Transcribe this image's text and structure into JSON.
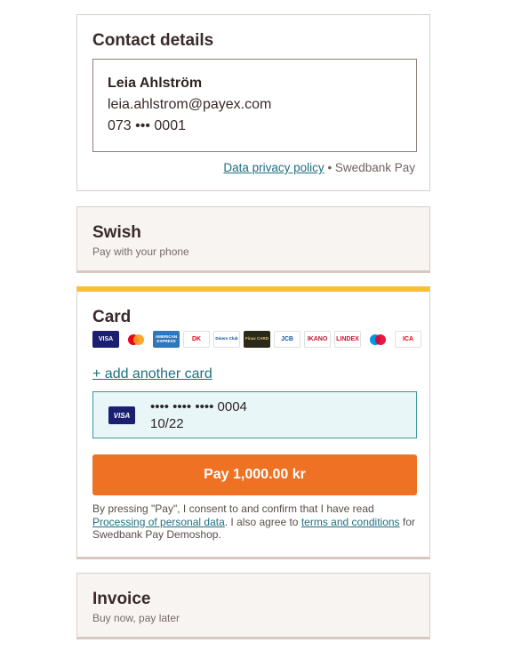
{
  "contact": {
    "title": "Contact details",
    "name": "Leia Ahlström",
    "email": "leia.ahlstrom@payex.com",
    "phone": "073 ••• 0001",
    "privacy_link": "Data privacy policy",
    "provider": "• Swedbank Pay"
  },
  "swish": {
    "title": "Swish",
    "subtitle": "Pay with your phone"
  },
  "card": {
    "title": "Card",
    "logos": [
      {
        "name": "visa-logo-icon",
        "text": "VISA",
        "bg": "#1a1f71",
        "fg": "#ffffff"
      },
      {
        "name": "mastercard-logo-icon",
        "text": "",
        "bg": "#ffffff",
        "fg": "#000000"
      },
      {
        "name": "amex-logo-icon",
        "text": "AMERICAN EXPRESS",
        "bg": "#2e77bb",
        "fg": "#ffffff"
      },
      {
        "name": "dankort-logo-icon",
        "text": "DK",
        "bg": "#ffffff",
        "fg": "#e3001b"
      },
      {
        "name": "diners-club-logo-icon",
        "text": "Diners Club",
        "bg": "#ffffff",
        "fg": "#004a97"
      },
      {
        "name": "finax-logo-icon",
        "text": "Finax CARD",
        "bg": "#2b2a1a",
        "fg": "#d9c27a"
      },
      {
        "name": "jcb-logo-icon",
        "text": "JCB",
        "bg": "#ffffff",
        "fg": "#0a5aa8"
      },
      {
        "name": "ikano-logo-icon",
        "text": "IKANO",
        "bg": "#ffffff",
        "fg": "#c8102e"
      },
      {
        "name": "lindex-logo-icon",
        "text": "LINDEX",
        "bg": "#ffffff",
        "fg": "#c8102e"
      },
      {
        "name": "maestro-logo-icon",
        "text": "",
        "bg": "#ffffff",
        "fg": "#000000"
      },
      {
        "name": "ica-logo-icon",
        "text": "ICA",
        "bg": "#ffffff",
        "fg": "#e3000f"
      }
    ],
    "add_card": "+ add another card",
    "saved_card": {
      "brand": "VISA",
      "number": "•••• •••• •••• 0004",
      "expiry": "10/22"
    },
    "pay_button": "Pay 1,000.00 kr",
    "consent_pre": "By pressing \"Pay\", I consent to and confirm that I have read ",
    "consent_link1": "Processing of personal data",
    "consent_mid": ". I also agree to ",
    "consent_link2": "terms and conditions",
    "consent_post": " for Swedbank Pay Demoshop."
  },
  "invoice": {
    "title": "Invoice",
    "subtitle": "Buy now, pay later"
  },
  "colors": {
    "accent_orange": "#ef7123",
    "accent_yellow": "#fbc02d",
    "link_teal": "#1f6f7f"
  }
}
